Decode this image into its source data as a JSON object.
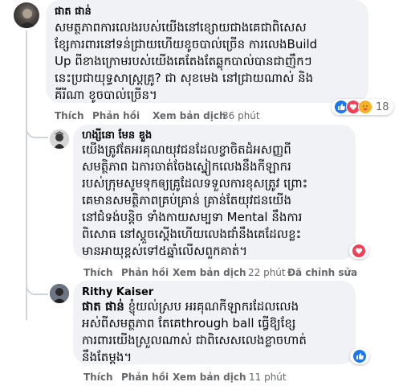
{
  "comments": [
    {
      "author": "ផាត ផាន់",
      "text_lines": [
        "សមត្ថភាពការលេងរបស់យើងនៅខ្សោយជាងគេជាពិសេស",
        "ខ្សែការពារនៅទន់ជ្រាយហើយខូចបាល់ច្រើន ការលេងBuild",
        "Up ពីខាងក្រោមរបស់យើងគេតែងតែឆ្លុកបាល់បានជាញឹកៗ",
        "នេះប្រជាយុទ្ធសាស្ត្រគ្រូ? ជា សុខមេង នៅជ្រាយណាស់ និង",
        "គីរីណា ខូចបាល់ច្រើន។"
      ],
      "actions": {
        "like": "Thích",
        "reply": "Phản hồi",
        "translate": "Xem bản dịch"
      },
      "time": "36 phút",
      "reaction_count": "18"
    },
    {
      "author": "ហង្សីនោ មែន ឌួង",
      "text_lines": [
        "យើងត្រូវតែអរគុណយុវជនដែលខ្វាចិតដំអសញ្ញពី",
        "សមត្ថិភាព ឯការចាត់ចែងស្នៀកលេងនឹងកីឡាករ",
        "របស់ក្រុមសូមទុកឲ្យគ្រូដែលទទួលការខុសត្រូវ ព្រោះ",
        "គេមានសមត្ថិភាពគ្រប់គ្រាន់ គ្រាន់តែយុវជនយើង",
        "នៅជំទង់បន្តិច ទាំងកាយសម្បទា Mental នឹងការ",
        "ពិសោធ នៅស្តួចស្តើងហើយលេងជាំនឹងគេដែលខ្លះ",
        "មានអាយុខ្ពស់ទៅ៥ឆ្នាំលើសពួកគាត់។"
      ],
      "actions": {
        "like": "Thích",
        "reply": "Phản hồi",
        "translate": "Xem bản dịch"
      },
      "time": "22 phút",
      "edited": "Đã chỉnh sửa"
    },
    {
      "author": "Rithy Kaiser",
      "mention": "ផាត ផាន់",
      "text_lines": [
        "ខ្ញុំយល់ស្រប អរគុណកីឡាករដែលលេង",
        "អស់ពីសមត្ថភាព តែគេthrough ball ធ្វើឱ្យខ្សែ",
        "ការពារយើងស្រួលណាស់ ជាពិសេសលេងខ្លាចហាត់",
        "នឹងតែម្តង។"
      ],
      "actions": {
        "like": "Thích",
        "reply": "Phản hồi",
        "translate": "Xem bản dịch"
      },
      "time": "11 phút"
    }
  ],
  "icons": {
    "like": "like-icon",
    "love": "love-icon",
    "care": "care-icon"
  },
  "colors": {
    "bubble": "#f0f2f5",
    "meta": "#65676b",
    "like_blue": "#1877f2",
    "love_red": "#f33e58"
  }
}
